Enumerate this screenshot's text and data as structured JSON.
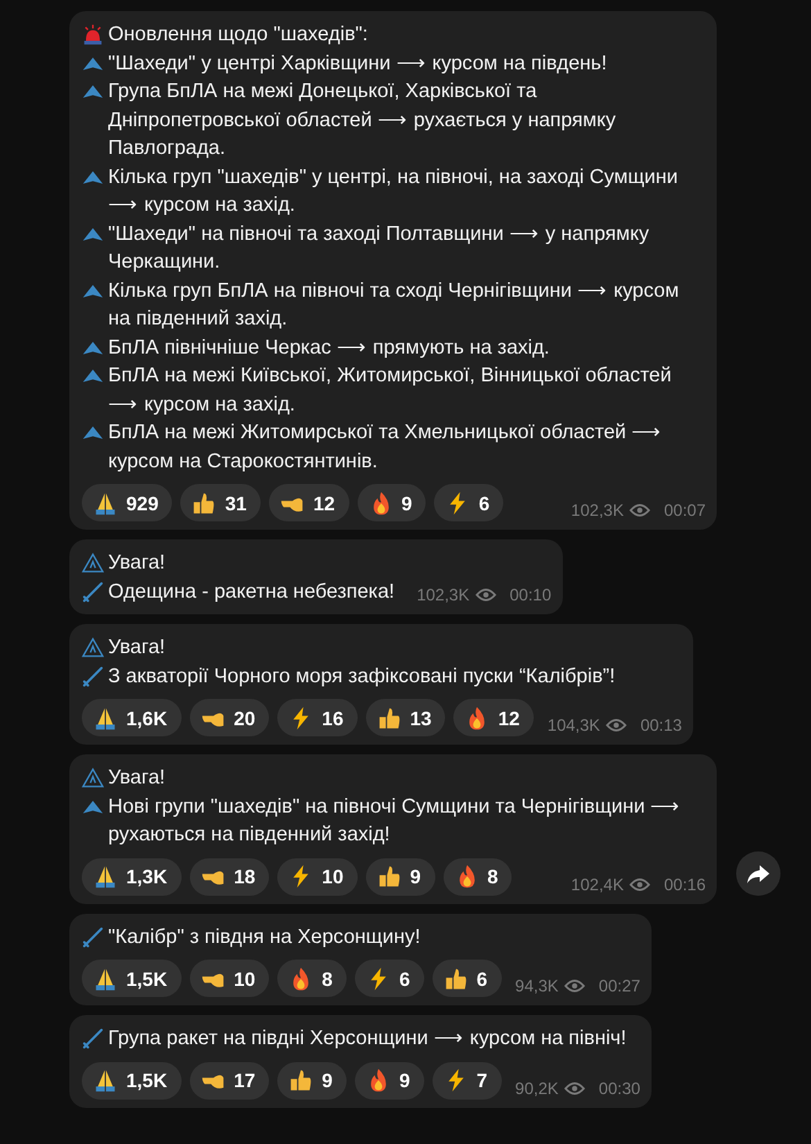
{
  "messages": [
    {
      "share": false,
      "lines": [
        {
          "kind": "siren",
          "text": "Оновлення щодо \"шахедів\":"
        },
        {
          "kind": "drone",
          "text": "\"Шахеди\" у центрі Харківщини ⟶ курсом на південь!"
        },
        {
          "kind": "drone",
          "text": "Група БпЛА на межі Донецької, Харківської та Дніпропетровської областей ⟶ рухається у напрямку Павлограда."
        },
        {
          "kind": "drone",
          "text": "Кілька груп \"шахедів\" у центрі, на півночі, на заході Сумщини ⟶ курсом на захід."
        },
        {
          "kind": "drone",
          "text": "\"Шахеди\" на півночі та заході Полтавщини ⟶ у напрямку Черкащини."
        },
        {
          "kind": "drone",
          "text": "Кілька груп БпЛА на півночі та сході Чернігівщини ⟶ курсом на південний захід."
        },
        {
          "kind": "drone",
          "text": "БпЛА північніше Черкас ⟶ прямують на захід."
        },
        {
          "kind": "drone",
          "text": "БпЛА на межі Київської, Житомирської, Вінницької областей ⟶ курсом на захід."
        },
        {
          "kind": "drone",
          "text": "БпЛА на межі Житомирської та Хмельницької областей ⟶ курсом на Старокостянтинів."
        }
      ],
      "reactions": [
        {
          "kind": "pray",
          "count": "929"
        },
        {
          "kind": "thumb",
          "count": "31"
        },
        {
          "kind": "point",
          "count": "12"
        },
        {
          "kind": "fire",
          "count": "9"
        },
        {
          "kind": "zap",
          "count": "6"
        }
      ],
      "views": "102,3K",
      "time": "00:07"
    },
    {
      "share": false,
      "lines": [
        {
          "kind": "warning",
          "text": "Увага!"
        },
        {
          "kind": "missile",
          "text": "Одещина - ракетна небезпека!"
        }
      ],
      "views": "102,3K",
      "time": "00:10"
    },
    {
      "share": false,
      "lines": [
        {
          "kind": "warning",
          "text": "Увага!"
        },
        {
          "kind": "missile",
          "text": "З акваторії Чорного моря зафіксовані пуски “Калібрів”!"
        }
      ],
      "reactions": [
        {
          "kind": "pray",
          "count": "1,6K"
        },
        {
          "kind": "point",
          "count": "20"
        },
        {
          "kind": "zap",
          "count": "16"
        },
        {
          "kind": "thumb",
          "count": "13"
        },
        {
          "kind": "fire",
          "count": "12"
        }
      ],
      "views": "104,3K",
      "time": "00:13"
    },
    {
      "share": true,
      "lines": [
        {
          "kind": "warning",
          "text": "Увага!"
        },
        {
          "kind": "drone",
          "text": "Нові групи \"шахедів\" на півночі Сумщини та Чернігівщини ⟶ рухаються на південний захід!"
        }
      ],
      "reactions": [
        {
          "kind": "pray",
          "count": "1,3K"
        },
        {
          "kind": "point",
          "count": "18"
        },
        {
          "kind": "zap",
          "count": "10"
        },
        {
          "kind": "thumb",
          "count": "9"
        },
        {
          "kind": "fire",
          "count": "8"
        }
      ],
      "views": "102,4K",
      "time": "00:16"
    },
    {
      "share": false,
      "lines": [
        {
          "kind": "missile",
          "text": "\"Калібр\" з півдня на Херсонщину!"
        }
      ],
      "reactions": [
        {
          "kind": "pray",
          "count": "1,5K"
        },
        {
          "kind": "point",
          "count": "10"
        },
        {
          "kind": "fire",
          "count": "8"
        },
        {
          "kind": "zap",
          "count": "6"
        },
        {
          "kind": "thumb",
          "count": "6"
        }
      ],
      "views": "94,3K",
      "time": "00:27"
    },
    {
      "share": false,
      "lines": [
        {
          "kind": "missile",
          "text": "Група ракет на півдні Херсонщини ⟶ курсом на північ!"
        }
      ],
      "reactions": [
        {
          "kind": "pray",
          "count": "1,5K"
        },
        {
          "kind": "point",
          "count": "17"
        },
        {
          "kind": "thumb",
          "count": "9"
        },
        {
          "kind": "fire",
          "count": "9"
        },
        {
          "kind": "zap",
          "count": "7"
        }
      ],
      "views": "90,2K",
      "time": "00:30"
    }
  ]
}
